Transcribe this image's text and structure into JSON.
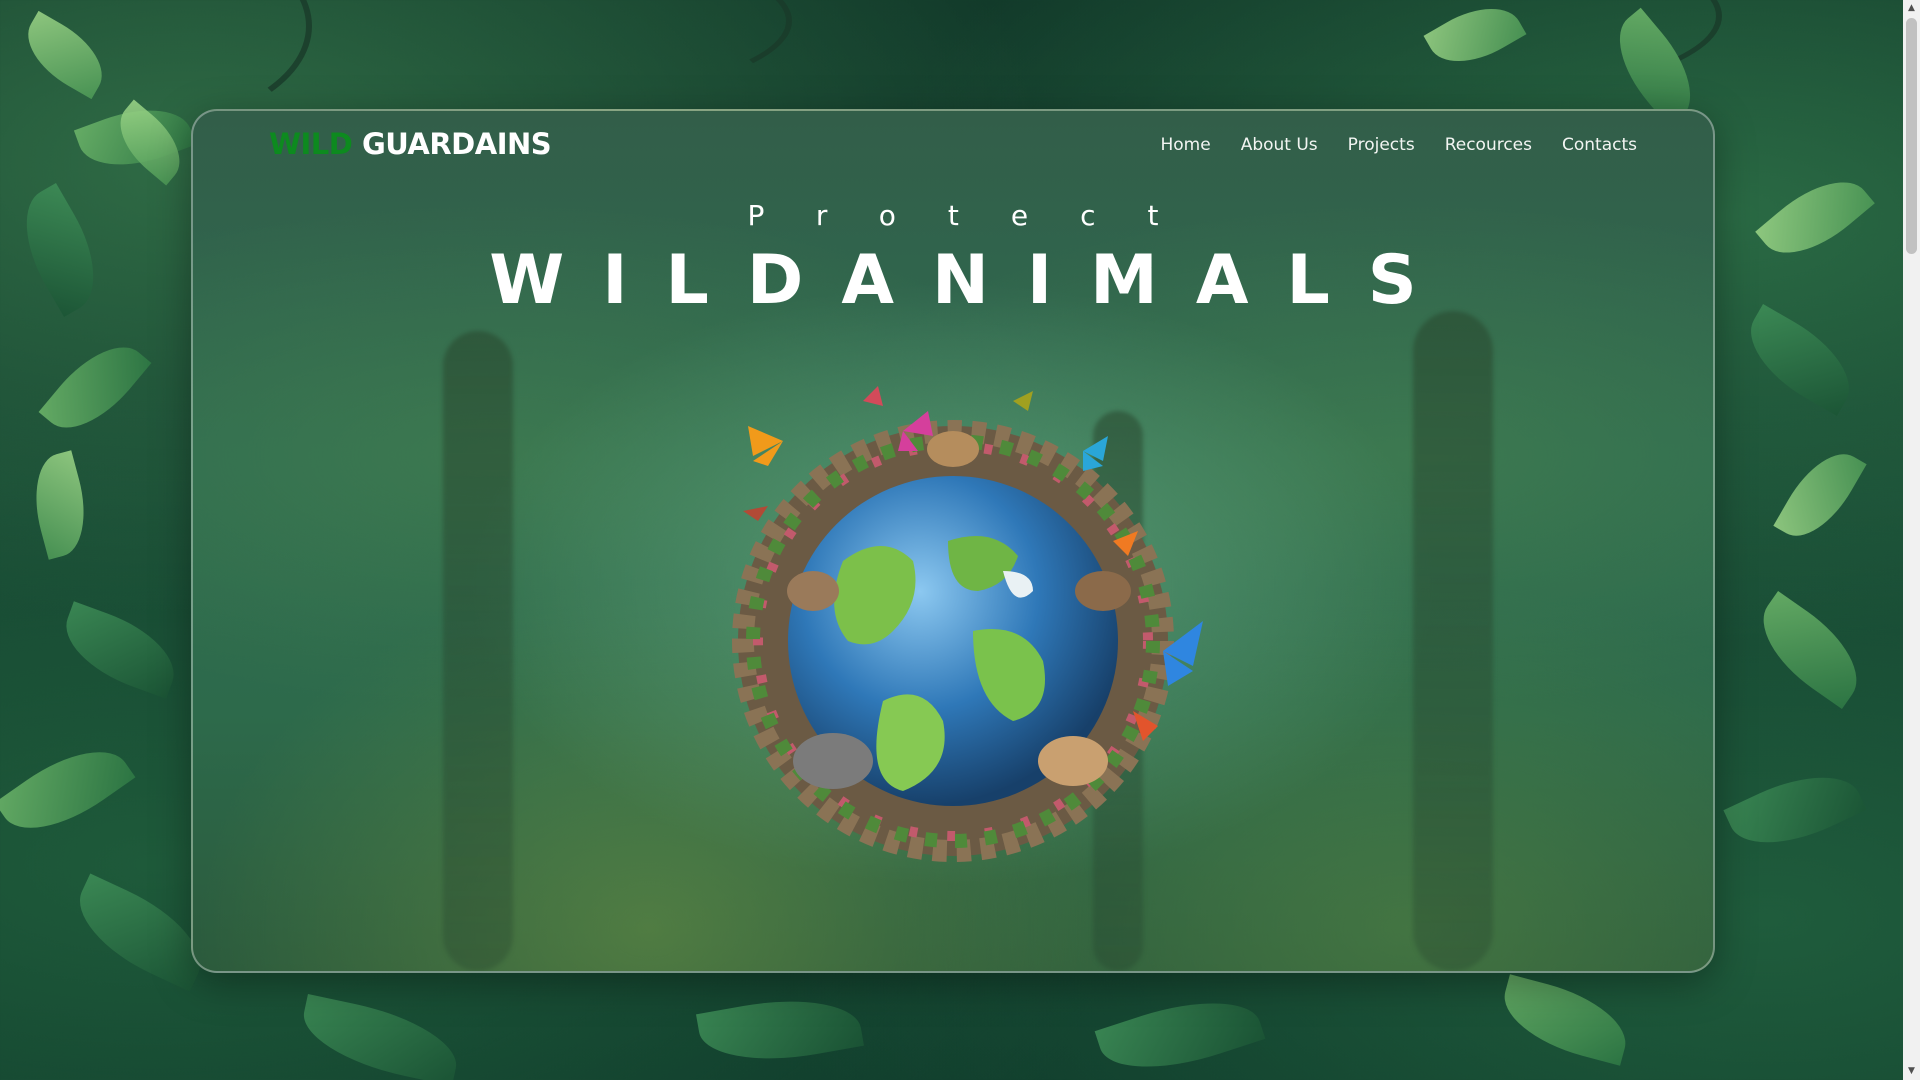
{
  "brand": {
    "part1": "WILD",
    "part2": "GUARDAINS"
  },
  "nav": {
    "items": [
      "Home",
      "About Us",
      "Projects",
      "Recources",
      "Contacts"
    ]
  },
  "hero": {
    "kicker": "Protect",
    "headline": "WILDANIMALS",
    "image": "earth-globe-with-animals-and-butterflies"
  },
  "colors": {
    "brand_green": "#0d8a1f",
    "text": "#ffffff",
    "jungle_dark": "#123a2a"
  },
  "scrollbar": {
    "up_icon": "up-arrow-icon",
    "down_icon": "down-arrow-icon"
  }
}
